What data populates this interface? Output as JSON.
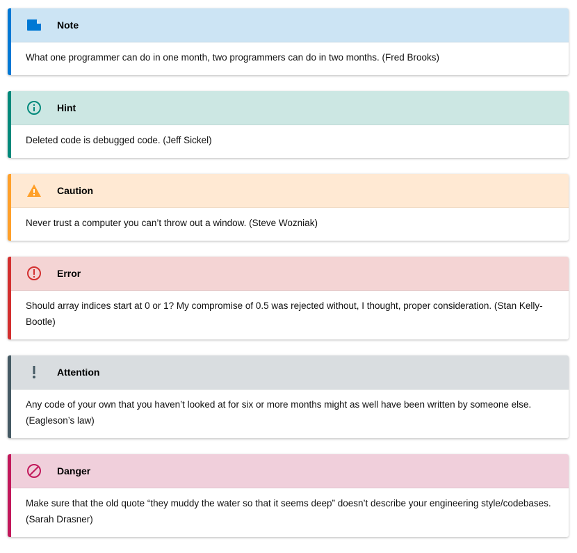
{
  "admonitions": [
    {
      "type": "note",
      "title": "Note",
      "icon": "note-icon",
      "accent": "#0078d4",
      "bg": "#cce4f4",
      "text": "What one programmer can do in one month, two programmers can do in two months. (Fred Brooks)"
    },
    {
      "type": "hint",
      "title": "Hint",
      "icon": "info-icon",
      "accent": "#00897b",
      "bg": "#cce7e3",
      "text": "Deleted code is debugged code. (Jeff Sickel)"
    },
    {
      "type": "caution",
      "title": "Caution",
      "icon": "warning-icon",
      "accent": "#ffa02a",
      "bg": "#ffe9d3",
      "text": "Never trust a computer you can’t throw out a window. (Steve Wozniak)"
    },
    {
      "type": "error",
      "title": "Error",
      "icon": "error-icon",
      "accent": "#d32f2f",
      "bg": "#f4d4d4",
      "text": "Should array indices start at 0 or 1? My compromise of 0.5 was rejected without, I thought, proper consideration. (Stan Kelly-Bootle)"
    },
    {
      "type": "attention",
      "title": "Attention",
      "icon": "exclamation-icon",
      "accent": "#455a64",
      "bg": "#d9dde0",
      "text": "Any code of your own that you haven’t looked at for six or more months might as well have been written by someone else. (Eagleson’s law)"
    },
    {
      "type": "danger",
      "title": "Danger",
      "icon": "prohibited-icon",
      "accent": "#c2185b",
      "bg": "#f0cfdb",
      "text": "Make sure that the old quote “they muddy the water so that it seems deep” doesn’t describe your engineering style/codebases. (Sarah Drasner)"
    }
  ]
}
